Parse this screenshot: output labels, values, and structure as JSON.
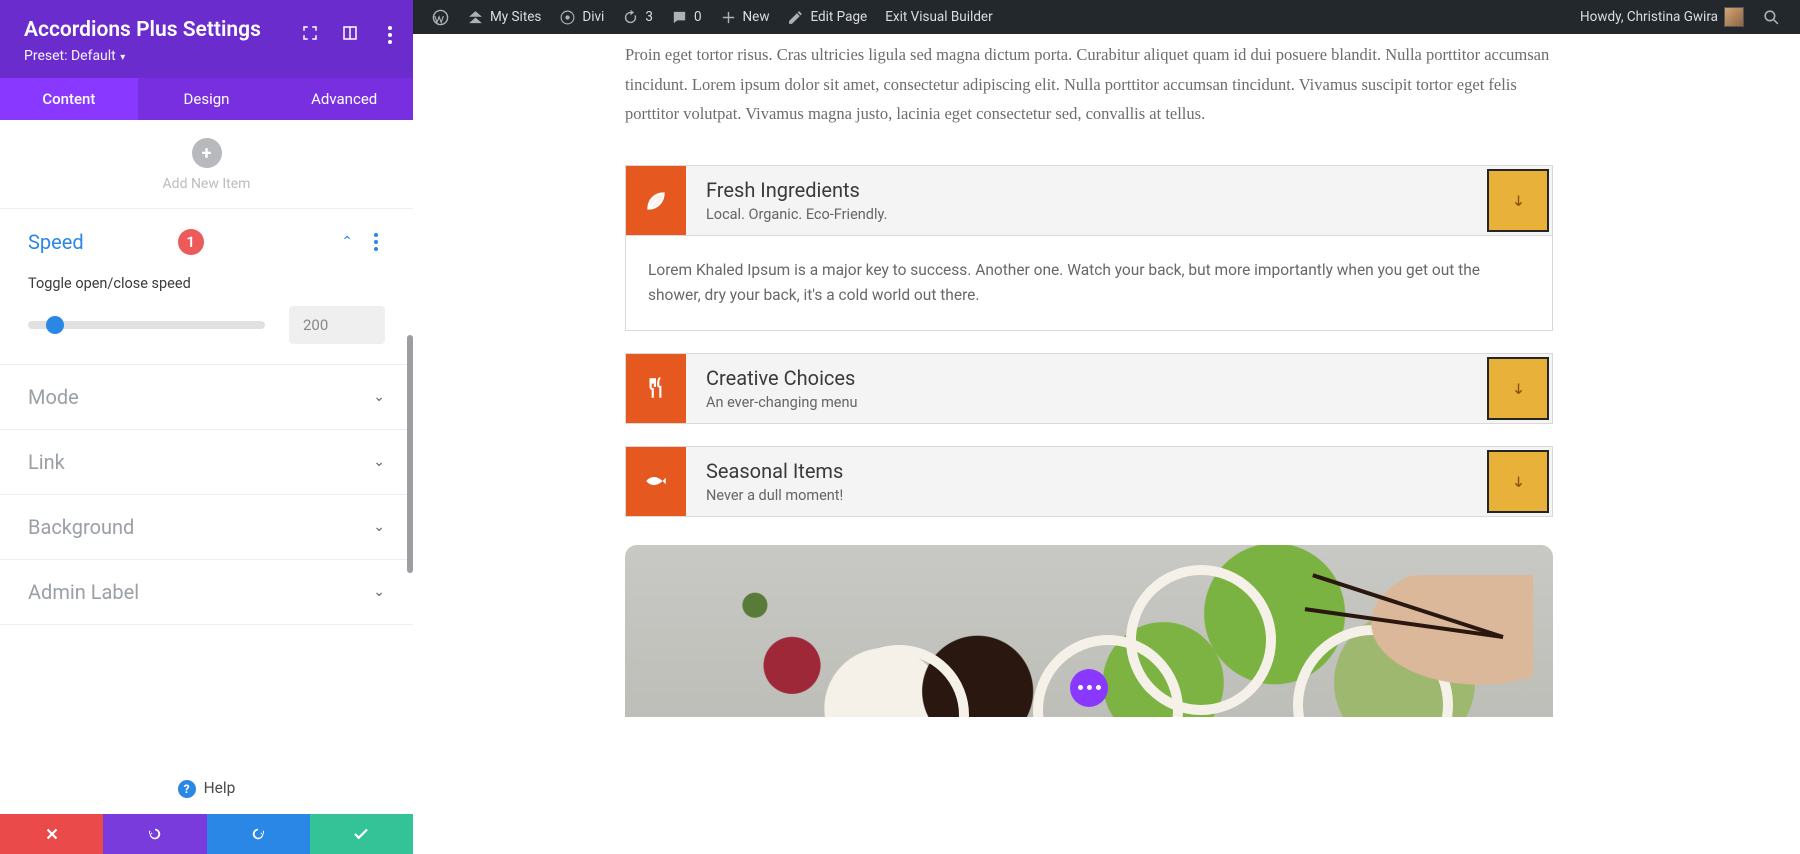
{
  "panel": {
    "title": "Accordions Plus Settings",
    "preset_label": "Preset: Default",
    "tabs": {
      "content": "Content",
      "design": "Design",
      "advanced": "Advanced"
    },
    "add_item": "Add New Item",
    "sections": {
      "speed": {
        "title": "Speed",
        "badge": "1",
        "field_label": "Toggle open/close speed",
        "value": "200"
      },
      "mode": {
        "title": "Mode"
      },
      "link": {
        "title": "Link"
      },
      "background": {
        "title": "Background"
      },
      "admin_label": {
        "title": "Admin Label"
      }
    },
    "help": "Help"
  },
  "adminbar": {
    "my_sites": "My Sites",
    "site_name": "Divi",
    "updates": "3",
    "comments": "0",
    "new": "New",
    "edit_page": "Edit Page",
    "exit_vb": "Exit Visual Builder",
    "howdy": "Howdy, Christina Gwira"
  },
  "page": {
    "lead": "Proin eget tortor risus. Cras ultricies ligula sed magna dictum porta. Curabitur aliquet quam id dui posuere blandit. Nulla porttitor accumsan tincidunt. Lorem ipsum dolor sit amet, consectetur adipiscing elit. Nulla porttitor accumsan tincidunt. Vivamus suscipit tortor eget felis porttitor volutpat. Vivamus magna justo, lacinia eget consectetur sed, convallis at tellus.",
    "accordions": [
      {
        "title": "Fresh Ingredients",
        "subtitle": "Local. Organic. Eco-Friendly.",
        "body": "Lorem Khaled Ipsum is a major key to success. Another one. Watch your back, but more importantly when you get out the shower, dry your back, it's a cold world out there.",
        "open": true,
        "icon": "leaf"
      },
      {
        "title": "Creative Choices",
        "subtitle": "An ever-changing menu",
        "open": false,
        "icon": "utensils"
      },
      {
        "title": "Seasonal Items",
        "subtitle": "Never a dull moment!",
        "open": false,
        "icon": "fish"
      }
    ]
  },
  "colors": {
    "brand_purple": "#782fe0",
    "accent_orange": "#e55820",
    "toggle_yellow": "#e8b13a",
    "blue": "#2b87e6"
  }
}
